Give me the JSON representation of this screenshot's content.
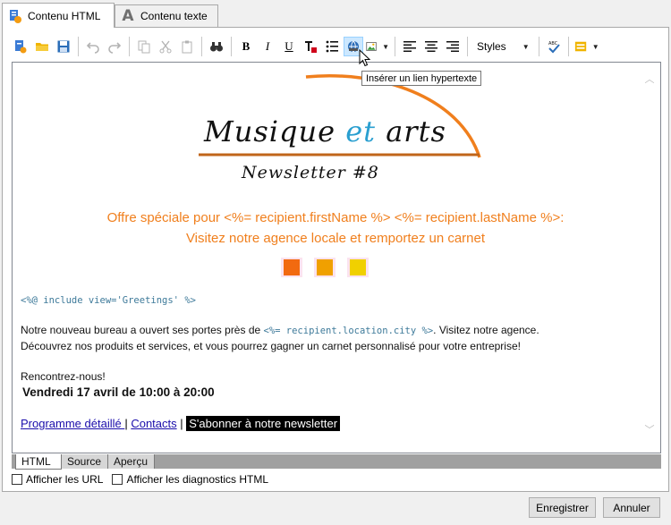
{
  "tabs": [
    {
      "label": "Contenu HTML",
      "active": true,
      "icon": "html-doc-icon"
    },
    {
      "label": "Contenu texte",
      "active": false,
      "icon": "text-a-icon"
    }
  ],
  "toolbar": {
    "bold": "B",
    "italic": "I",
    "underline": "U",
    "styles_label": "Styles",
    "tooltip": "Insérer un lien hypertexte"
  },
  "content": {
    "logo_part1": "Musique ",
    "logo_part2": "et",
    "logo_part3": " arts",
    "logo_subtitle": "Newsletter #8",
    "offer_line1": "Offre spéciale pour <%= recipient.firstName %> <%= recipient.lastName %>:",
    "offer_line2": "Visitez notre agence locale et remportez un carnet",
    "include_code": "<%@ include view='Greetings' %>",
    "para1_before": "Notre nouveau bureau a ouvert ses portes près de ",
    "para1_code": "<%= recipient.location.city %>",
    "para1_after": ". Visitez notre agence.",
    "para2": "Découvrez nos produits et services, et vous pourrez gagner un carnet personnalisé pour votre entreprise!",
    "meet": "Rencontrez-nous!",
    "date": "Vendredi 17 avril  de 10:00 à 20:00",
    "link_program": "Programme détaillé ",
    "sep1": " | ",
    "link_contacts": "Contacts",
    "sep2": " | ",
    "link_subscribe": "S'abonner à notre newsletter"
  },
  "colors": {
    "offer": "#f07f1d",
    "logo_et": "#2a9fd0",
    "square1": "#f26a10",
    "square2": "#f0a000",
    "square3": "#f0d000"
  },
  "view_tabs": [
    {
      "label": "HTML",
      "active": true
    },
    {
      "label": "Source",
      "active": false
    },
    {
      "label": "Aperçu",
      "active": false
    }
  ],
  "checkboxes": [
    {
      "label": "Afficher les URL",
      "checked": false
    },
    {
      "label": "Afficher les diagnostics HTML",
      "checked": false
    }
  ],
  "buttons": {
    "save": "Enregistrer",
    "cancel": "Annuler"
  }
}
